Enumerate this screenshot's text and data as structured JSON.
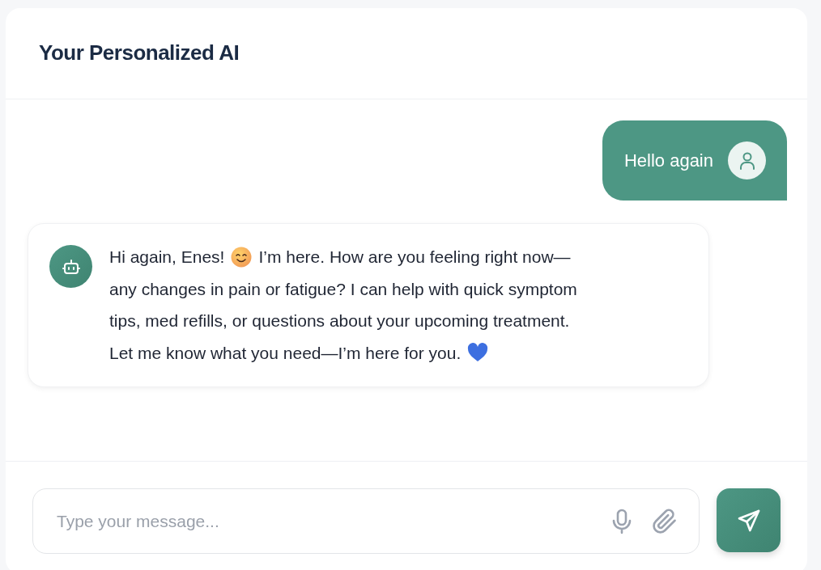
{
  "header": {
    "title": "Your Personalized AI"
  },
  "messages": [
    {
      "kind": "user",
      "lines": [
        [
          {
            "kind": "text",
            "text": "Hello again"
          }
        ]
      ]
    },
    {
      "kind": "bot",
      "lines": [
        [
          {
            "kind": "text",
            "text": "Hi again, Enes!"
          },
          {
            "kind": "smile"
          },
          {
            "kind": "text",
            "text": "I’m here. How are you feeling right now—"
          }
        ],
        [
          {
            "kind": "text",
            "text": "any changes in pain or fatigue? I can help with quick symptom"
          }
        ],
        [
          {
            "kind": "text",
            "text": "tips, med refills, or questions about your upcoming treatment."
          }
        ],
        [
          {
            "kind": "text",
            "text": "Let me know what you need—I’m here for you."
          },
          {
            "kind": "heart"
          }
        ]
      ]
    }
  ],
  "composer": {
    "placeholder": "Type your message..."
  }
}
